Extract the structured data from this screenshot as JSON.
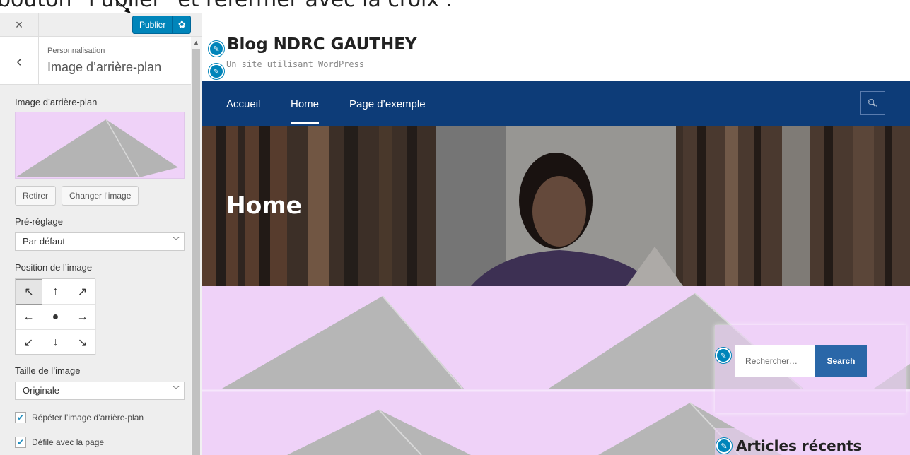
{
  "annotation": {
    "text": "bouton \"Publier\" et refermer avec la croix ."
  },
  "sidebar": {
    "close_icon": "×",
    "publish_label": "Publier",
    "settings_icon": "gear-icon",
    "back_icon": "‹",
    "breadcrumb": "Personnalisation",
    "section_title": "Image d’arrière-plan",
    "image_label": "Image d’arrière-plan",
    "remove_label": "Retirer",
    "change_label": "Changer l’image",
    "preset_label": "Pré-réglage",
    "preset_value": "Par défaut",
    "position_label": "Position de l’image",
    "position_arrows": [
      "↖",
      "↑",
      "↗",
      "←",
      "●",
      "→",
      "↙",
      "↓",
      "↘"
    ],
    "size_label": "Taille de l’image",
    "size_value": "Originale",
    "repeat_label": "Répéter l’image d’arrière-plan",
    "scroll_label": "Défile avec la page"
  },
  "preview": {
    "site_title": "Blog NDRC GAUTHEY",
    "site_description": "Un site utilisant WordPress",
    "nav_items": [
      "Accueil",
      "Home",
      "Page d’exemple"
    ],
    "active_nav": "Home",
    "hero_title": "Home",
    "search_placeholder": "Rechercher…",
    "search_button": "Search",
    "recent_title": "Articles récents"
  },
  "colors": {
    "background": "#efd2f8",
    "accent": "#0085ba",
    "nav": "#0d3c78"
  }
}
